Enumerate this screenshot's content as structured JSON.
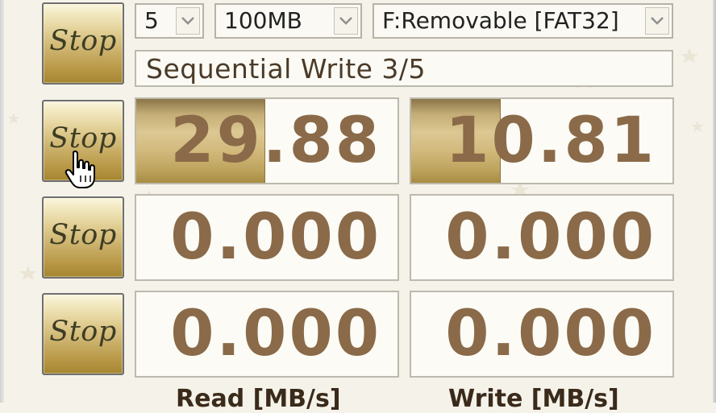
{
  "window": {
    "title": ""
  },
  "controls": {
    "test_count": "5",
    "test_size": "100MB",
    "drive": "F:Removable [FAT32]"
  },
  "status": "Sequential Write 3/5",
  "buttons": {
    "all_label": "Stop",
    "seq_label": "Stop",
    "rnd512_label": "Stop",
    "rnd4k_label": "Stop"
  },
  "results": {
    "seq_read": "29.88",
    "seq_write": "10.81",
    "rnd512_read": "0.000",
    "rnd512_write": "0.000",
    "rnd4k_read": "0.000",
    "rnd4k_write": "0.000"
  },
  "progress": {
    "seq_read_fraction": 0.49,
    "seq_write_fraction": 0.34
  },
  "columns": {
    "read_header": "Read [MB/s]",
    "write_header": "Write [MB/s]"
  },
  "colors": {
    "score_text": "#8a6a48",
    "button_gold": "#c9ae67",
    "background": "#f5f2ea"
  }
}
